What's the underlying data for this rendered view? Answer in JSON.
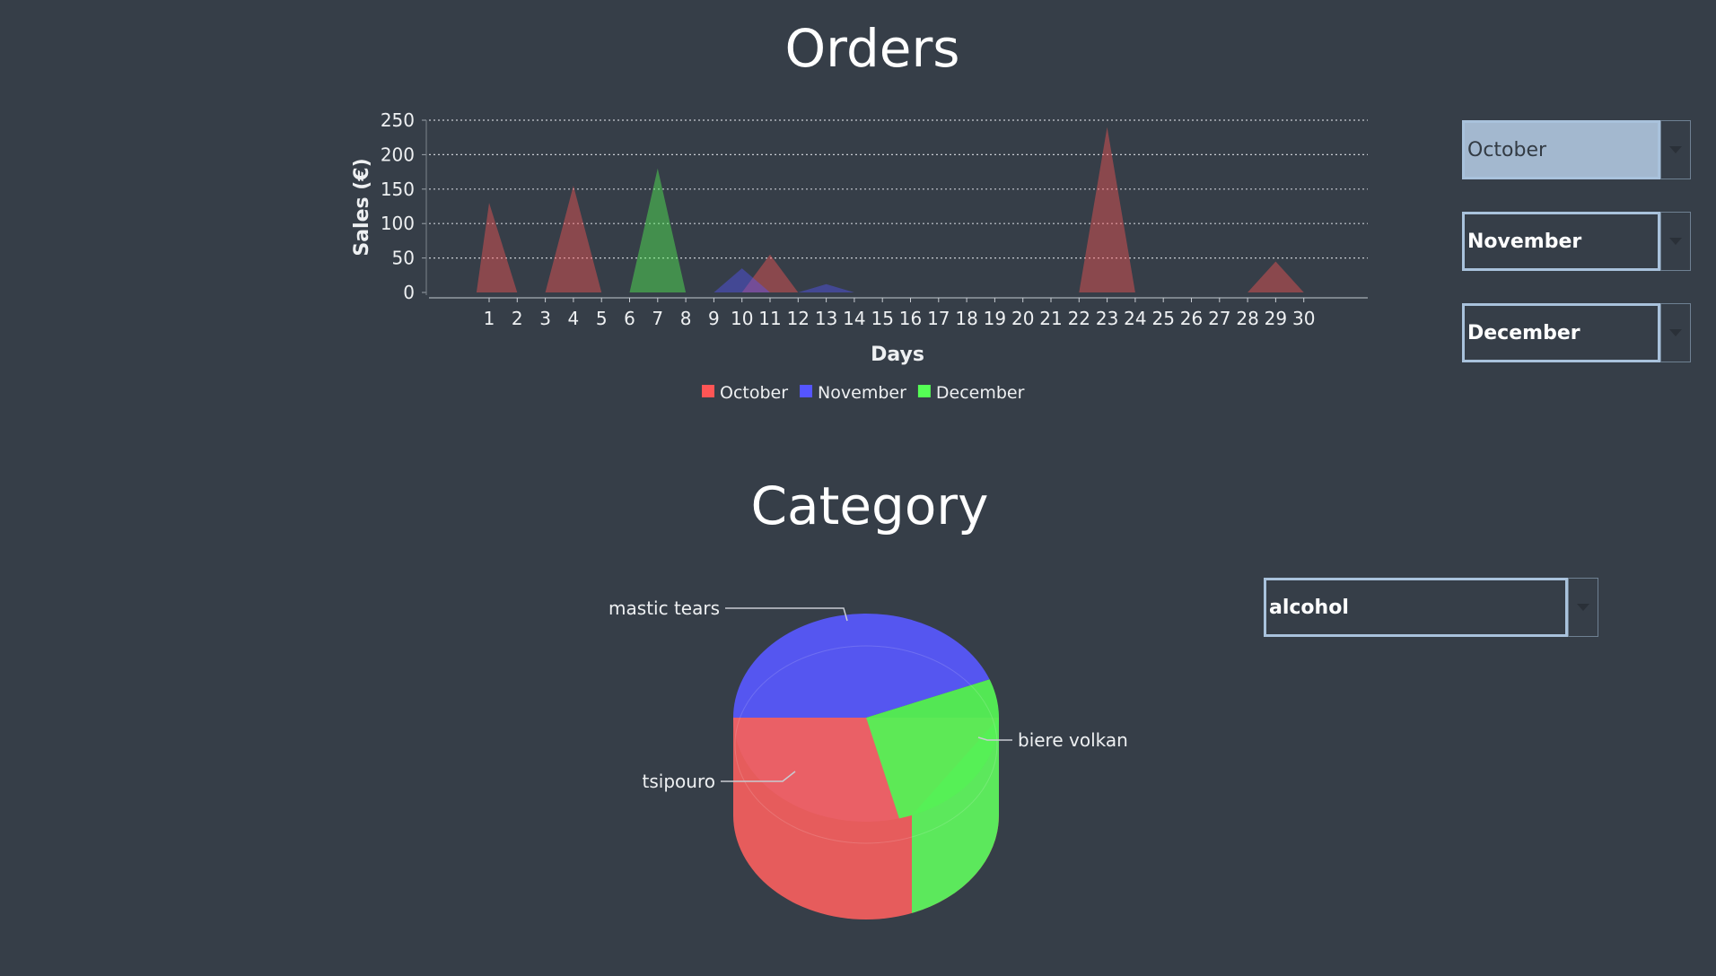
{
  "orders": {
    "title": "Orders",
    "month_selectors": [
      {
        "value": "October",
        "selected": true
      },
      {
        "value": "November",
        "selected": false
      },
      {
        "value": "December",
        "selected": false
      }
    ]
  },
  "category": {
    "title": "Category",
    "selector": {
      "value": "alcohol"
    }
  },
  "colors": {
    "background": "#363e48",
    "october": "#ff5555",
    "november": "#5555ff",
    "december": "#55ff55"
  },
  "chart_data": [
    {
      "type": "area",
      "xlabel": "Days",
      "ylabel": "Sales (€)",
      "ylim": [
        0,
        250
      ],
      "yticks": [
        0,
        50,
        100,
        150,
        200,
        250
      ],
      "categories": [
        "1",
        "2",
        "3",
        "4",
        "5",
        "6",
        "7",
        "8",
        "9",
        "10",
        "11",
        "12",
        "13",
        "14",
        "15",
        "16",
        "17",
        "18",
        "19",
        "20",
        "21",
        "22",
        "23",
        "24",
        "25",
        "26",
        "27",
        "28",
        "29",
        "30"
      ],
      "grid": true,
      "legend_position": "bottom",
      "series": [
        {
          "name": "October",
          "color": "#ff5555",
          "values": [
            130,
            0,
            0,
            155,
            0,
            0,
            0,
            0,
            0,
            0,
            55,
            0,
            0,
            0,
            0,
            0,
            0,
            0,
            0,
            0,
            0,
            0,
            240,
            0,
            0,
            0,
            0,
            0,
            45,
            0
          ]
        },
        {
          "name": "November",
          "color": "#5555ff",
          "values": [
            0,
            0,
            0,
            0,
            0,
            0,
            0,
            0,
            0,
            35,
            0,
            0,
            12,
            0,
            0,
            0,
            0,
            0,
            0,
            0,
            0,
            0,
            0,
            0,
            0,
            0,
            0,
            0,
            0,
            0
          ]
        },
        {
          "name": "December",
          "color": "#55ff55",
          "values": [
            0,
            0,
            0,
            0,
            0,
            0,
            180,
            0,
            0,
            0,
            0,
            0,
            0,
            0,
            0,
            0,
            0,
            0,
            0,
            0,
            0,
            0,
            0,
            0,
            0,
            0,
            0,
            0,
            0,
            0
          ]
        }
      ]
    },
    {
      "type": "pie",
      "style": "3d",
      "slices": [
        {
          "label": "mastic tears",
          "value": 44,
          "color": "#5757fa"
        },
        {
          "label": "biere volkan",
          "value": 27,
          "color": "#55f055"
        },
        {
          "label": "tsipouro",
          "value": 29,
          "color": "#ea6066"
        }
      ]
    }
  ]
}
